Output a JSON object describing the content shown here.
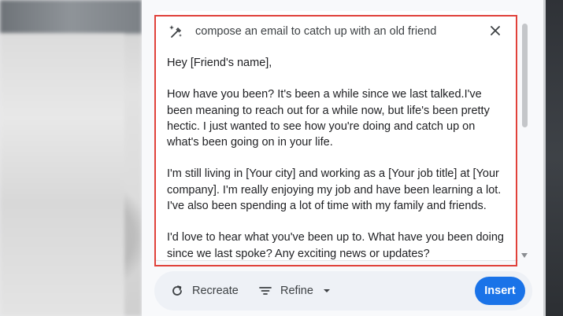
{
  "prompt": {
    "text": "compose an email to catch up with an old friend",
    "icon": "magic-pen-icon"
  },
  "email": {
    "paragraphs": [
      "Hey [Friend's name],",
      "How have you been? It's been a while since we last talked.I've been meaning to reach out for a while now, but life's been pretty hectic. I just wanted to see how you're doing and catch up on what's been going on in your life.",
      "I'm still living in [Your city] and working as a [Your job title] at [Your company]. I'm really enjoying my job and have been learning a lot. I've also been spending a lot of time with my family and friends.",
      "I'd love to hear what you've been up to. What have you been doing since we last spoke? Any exciting news or updates?"
    ]
  },
  "toolbar": {
    "recreate_label": "Recreate",
    "refine_label": "Refine",
    "insert_label": "Insert"
  },
  "colors": {
    "accent": "#1a73e8",
    "highlight": "#e0413a"
  }
}
